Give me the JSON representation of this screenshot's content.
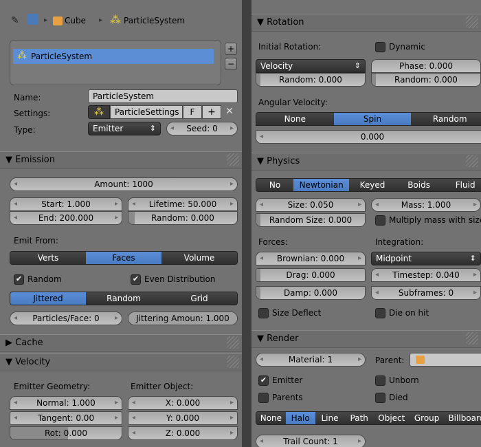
{
  "breadcrumb": {
    "object": "Cube",
    "system": "ParticleSystem"
  },
  "list": {
    "item": "ParticleSystem"
  },
  "props": {
    "name_label": "Name:",
    "name_value": "ParticleSystem",
    "settings_label": "Settings:",
    "settings_value": "ParticleSettings",
    "fake_user": "F",
    "type_label": "Type:",
    "type_value": "Emitter",
    "seed": "Seed: 0"
  },
  "emission": {
    "title": "Emission",
    "amount": "Amount: 1000",
    "start": "Start: 1.000",
    "lifetime": "Lifetime: 50.000",
    "end": "End: 200.000",
    "random": "Random: 0.000",
    "emit_from": "Emit From:",
    "emit_options": [
      "Verts",
      "Faces",
      "Volume"
    ],
    "random_cb": "Random",
    "even_cb": "Even Distribution",
    "dist_options": [
      "Jittered",
      "Random",
      "Grid"
    ],
    "particles_face": "Particles/Face: 0",
    "jittering": "Jittering Amoun: 1.000"
  },
  "cache": {
    "title": "Cache"
  },
  "velocity": {
    "title": "Velocity",
    "emitter_geometry": "Emitter Geometry:",
    "emitter_object": "Emitter Object:",
    "normal": "Normal: 1.000",
    "tangent": "Tangent: 0.00",
    "rot_label": "Rot:",
    "rot_value": "0.000",
    "x": "X: 0.000",
    "y": "Y: 0.000",
    "z": "Z: 0.000"
  },
  "rotation": {
    "title": "Rotation",
    "initial": "Initial Rotation:",
    "dynamic": "Dynamic",
    "velocity": "Velocity",
    "phase_label": "Phase:",
    "phase_value": "0.000",
    "random1": "Random: 0.000",
    "random2": "Random: 0.000",
    "angular": "Angular Velocity:",
    "ang_options": [
      "None",
      "Spin",
      "Random"
    ],
    "ang_value": "0.000"
  },
  "physics": {
    "title": "Physics",
    "types": [
      "No",
      "Newtonian",
      "Keyed",
      "Boids",
      "Fluid"
    ],
    "size": "Size: 0.050",
    "mass": "Mass: 1.000",
    "random_size": "Random Size: 0.000",
    "multiply_mass": "Multiply mass with size",
    "forces": "Forces:",
    "integration": "Integration:",
    "brownian": "Brownian: 0.000",
    "integration_value": "Midpoint",
    "drag": "Drag: 0.000",
    "timestep": "Timestep: 0.040",
    "damp": "Damp: 0.000",
    "subframes": "Subframes: 0",
    "size_deflect": "Size Deflect",
    "die_on_hit": "Die on hit"
  },
  "render": {
    "title": "Render",
    "material": "Material: 1",
    "parent": "Parent:",
    "emitter": "Emitter",
    "unborn": "Unborn",
    "parents": "Parents",
    "died": "Died",
    "types": [
      "None",
      "Halo",
      "Line",
      "Path",
      "Object",
      "Group",
      "Billboard"
    ],
    "trail_count": "Trail Count: 1"
  }
}
